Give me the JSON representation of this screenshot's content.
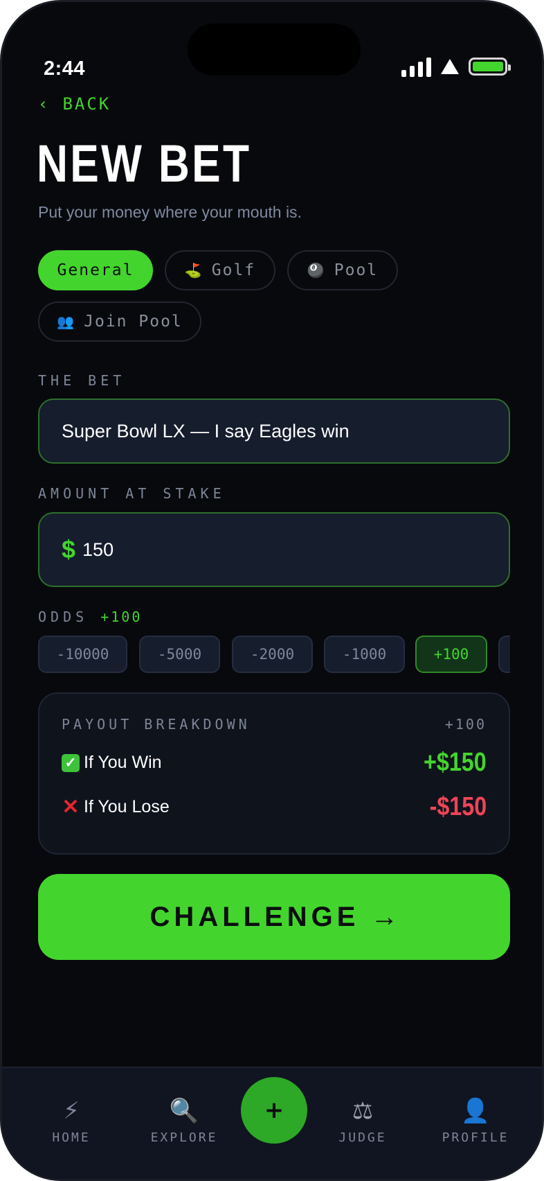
{
  "status": {
    "time": "2:44"
  },
  "nav": {
    "back_label": "BACK",
    "back_icon": "chevron-left-icon"
  },
  "header": {
    "title": "NEW BET",
    "subtitle": "Put your money where your mouth is."
  },
  "categories": [
    {
      "label": "General",
      "icon": "",
      "active": true
    },
    {
      "label": "Golf",
      "icon": "golf-flag-icon",
      "glyph": "⛳",
      "active": false
    },
    {
      "label": "Pool",
      "icon": "eight-ball-icon",
      "glyph": "🎱",
      "active": false
    },
    {
      "label": "Join Pool",
      "icon": "people-icon",
      "glyph": "👥",
      "active": false
    }
  ],
  "bet": {
    "label": "THE BET",
    "value": "Super Bowl LX — I say Eagles win"
  },
  "stake": {
    "label": "AMOUNT AT STAKE",
    "currency": "$",
    "value": "150"
  },
  "odds": {
    "label": "ODDS",
    "selected": "+100",
    "options": [
      "-10000",
      "-5000",
      "-2000",
      "-1000",
      "+100"
    ]
  },
  "payout": {
    "title": "PAYOUT BREAKDOWN",
    "odds": "+100",
    "win_label": "If You Win",
    "win_value": "+$150",
    "lose_label": "If You Lose",
    "lose_value": "-$150"
  },
  "cta": {
    "label": "CHALLENGE",
    "arrow": "→"
  },
  "tabbar": {
    "home": "HOME",
    "explore": "EXPLORE",
    "add": "+",
    "judge": "JUDGE",
    "profile": "PROFILE"
  },
  "colors": {
    "accent": "#43d52d",
    "background": "#08090d",
    "field": "#161d2d",
    "lose": "#ef4457"
  }
}
